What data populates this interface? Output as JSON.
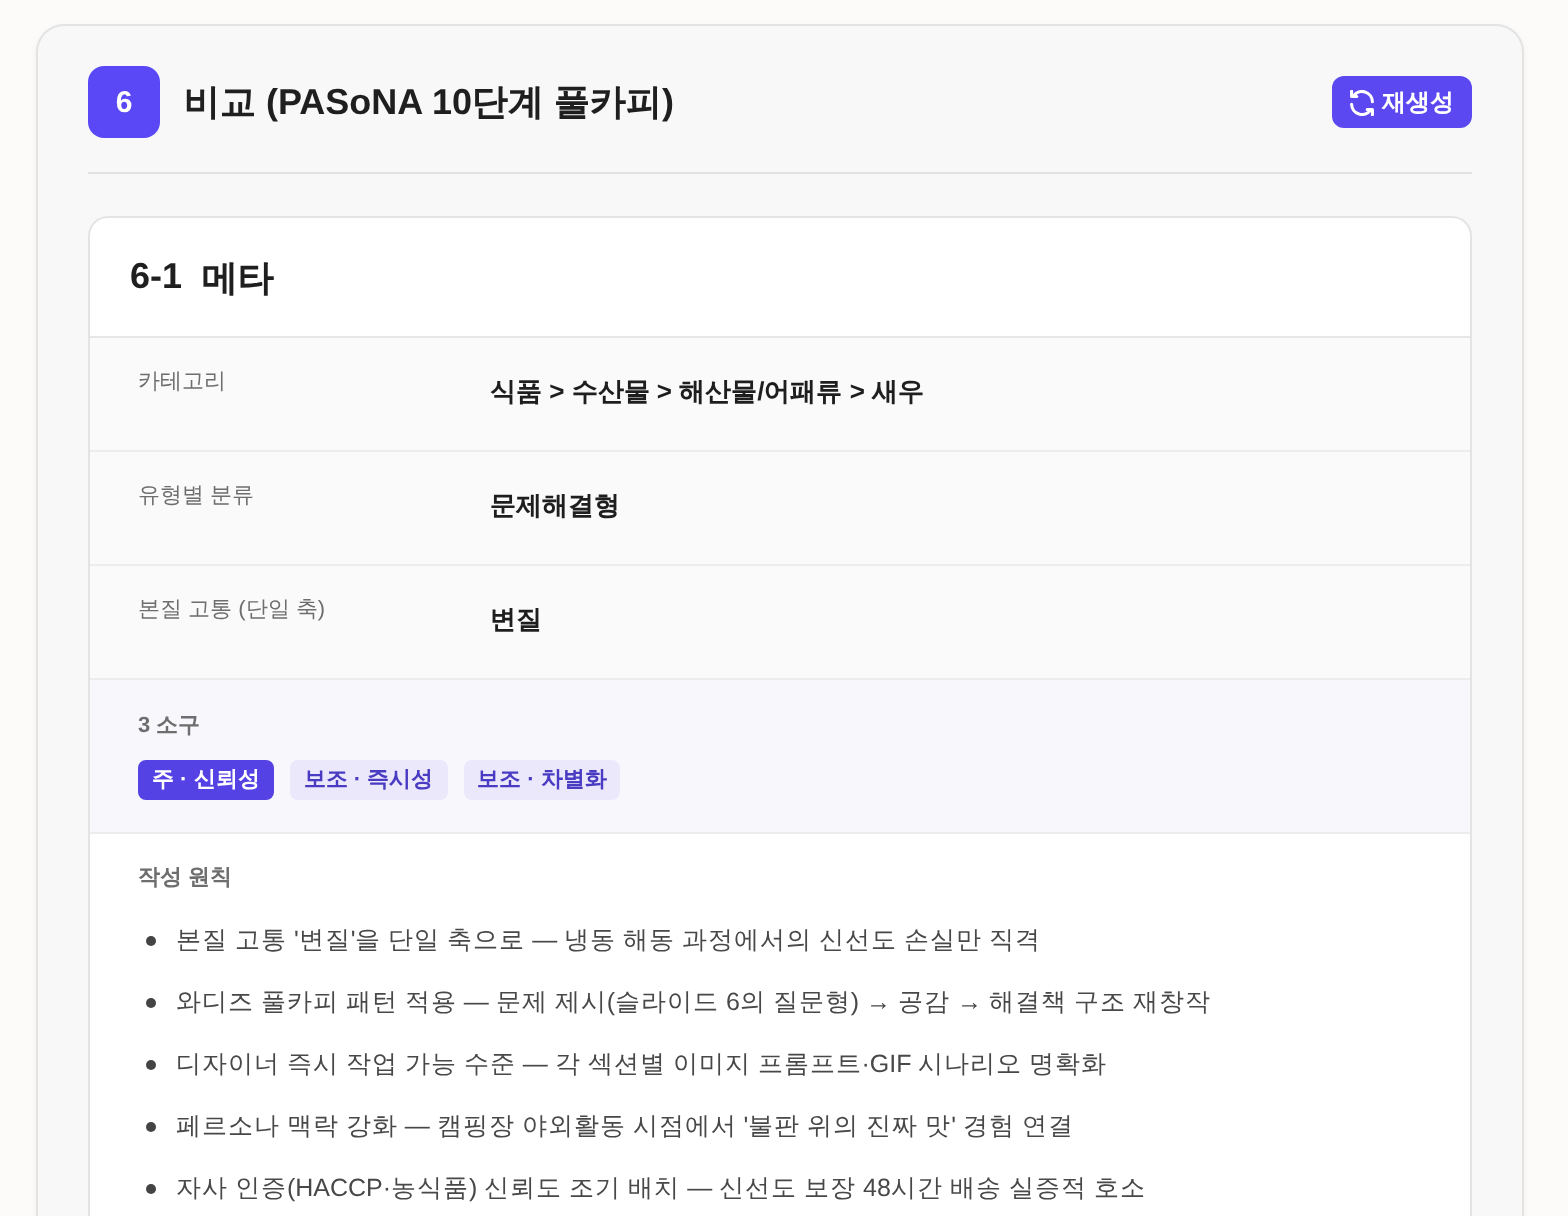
{
  "section": {
    "number": "6",
    "title": "비교 (PASoNA 10단계 풀카피)",
    "action": "재생성"
  },
  "panel": {
    "number": "6-1",
    "title": "메타",
    "rows": [
      {
        "kind": "field",
        "label": "카테고리",
        "value": "식품 > 수산물 > 해산물/어패류 > 새우"
      },
      {
        "kind": "field",
        "label": "유형별 분류",
        "value": "문제해결형"
      },
      {
        "kind": "field",
        "label": "본질 고통 (단일 축)",
        "value": "변질"
      },
      {
        "kind": "tags",
        "label": "3 소구",
        "tags": [
          {
            "text": "주 · 신뢰성",
            "primary": true
          },
          {
            "text": "보조 · 즉시성",
            "primary": false
          },
          {
            "text": "보조 · 차별화",
            "primary": false
          }
        ]
      },
      {
        "kind": "list",
        "label": "작성 원칙",
        "items": [
          "본질 고통 '변질'을 단일 축으로 — 냉동 해동 과정에서의 신선도 손실만 직격",
          "와디즈 풀카피 패턴 적용 — 문제 제시(슬라이드 6의 질문형) → 공감 → 해결책 구조 재창작",
          "디자이너 즉시 작업 가능 수준 — 각 섹션별 이미지 프롬프트·GIF 시나리오 명확화",
          "페르소나 맥락 강화 — 캠핑장 야외활동 시점에서 '불판 위의 진짜 맛' 경험 연결",
          "자사 인증(HACCP·농식품) 신뢰도 조기 배치 — 신선도 보장 48시간 배송 실증적 호소"
        ]
      }
    ]
  }
}
